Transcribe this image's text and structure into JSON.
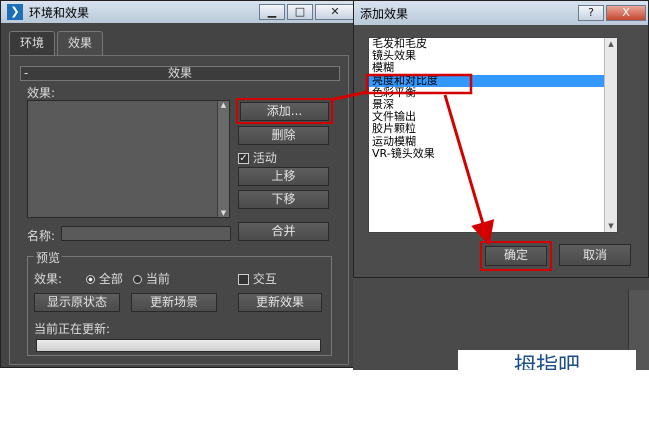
{
  "main_window": {
    "title": "环境和效果",
    "tabs": [
      "环境",
      "效果"
    ],
    "section_title": "效果",
    "effects_label": "效果:",
    "buttons": {
      "add": "添加...",
      "delete": "删除",
      "move_up": "上移",
      "move_down": "下移",
      "merge": "合并"
    },
    "active_checkbox": "活动",
    "name_label": "名称:",
    "preview": {
      "group_title": "预览",
      "effects_label": "效果:",
      "radio_all": "全部",
      "radio_current": "当前",
      "interactive": "交互",
      "show_original": "显示原状态",
      "update_scene": "更新场景",
      "update_effect": "更新效果",
      "updating_label": "当前正在更新:"
    }
  },
  "dialog": {
    "title": "添加效果",
    "items": [
      "毛发和毛皮",
      "镜头效果",
      "模糊",
      "亮度和对比度",
      "色彩平衡",
      "景深",
      "文件输出",
      "胶片颗粒",
      "运动模糊",
      "VR-镜头效果"
    ],
    "selected_index": 3,
    "ok": "确定",
    "cancel": "取消"
  },
  "window_controls": {
    "help": "?",
    "close": "X"
  },
  "annotation_color": "#d40000",
  "watermark": "拇指吧"
}
